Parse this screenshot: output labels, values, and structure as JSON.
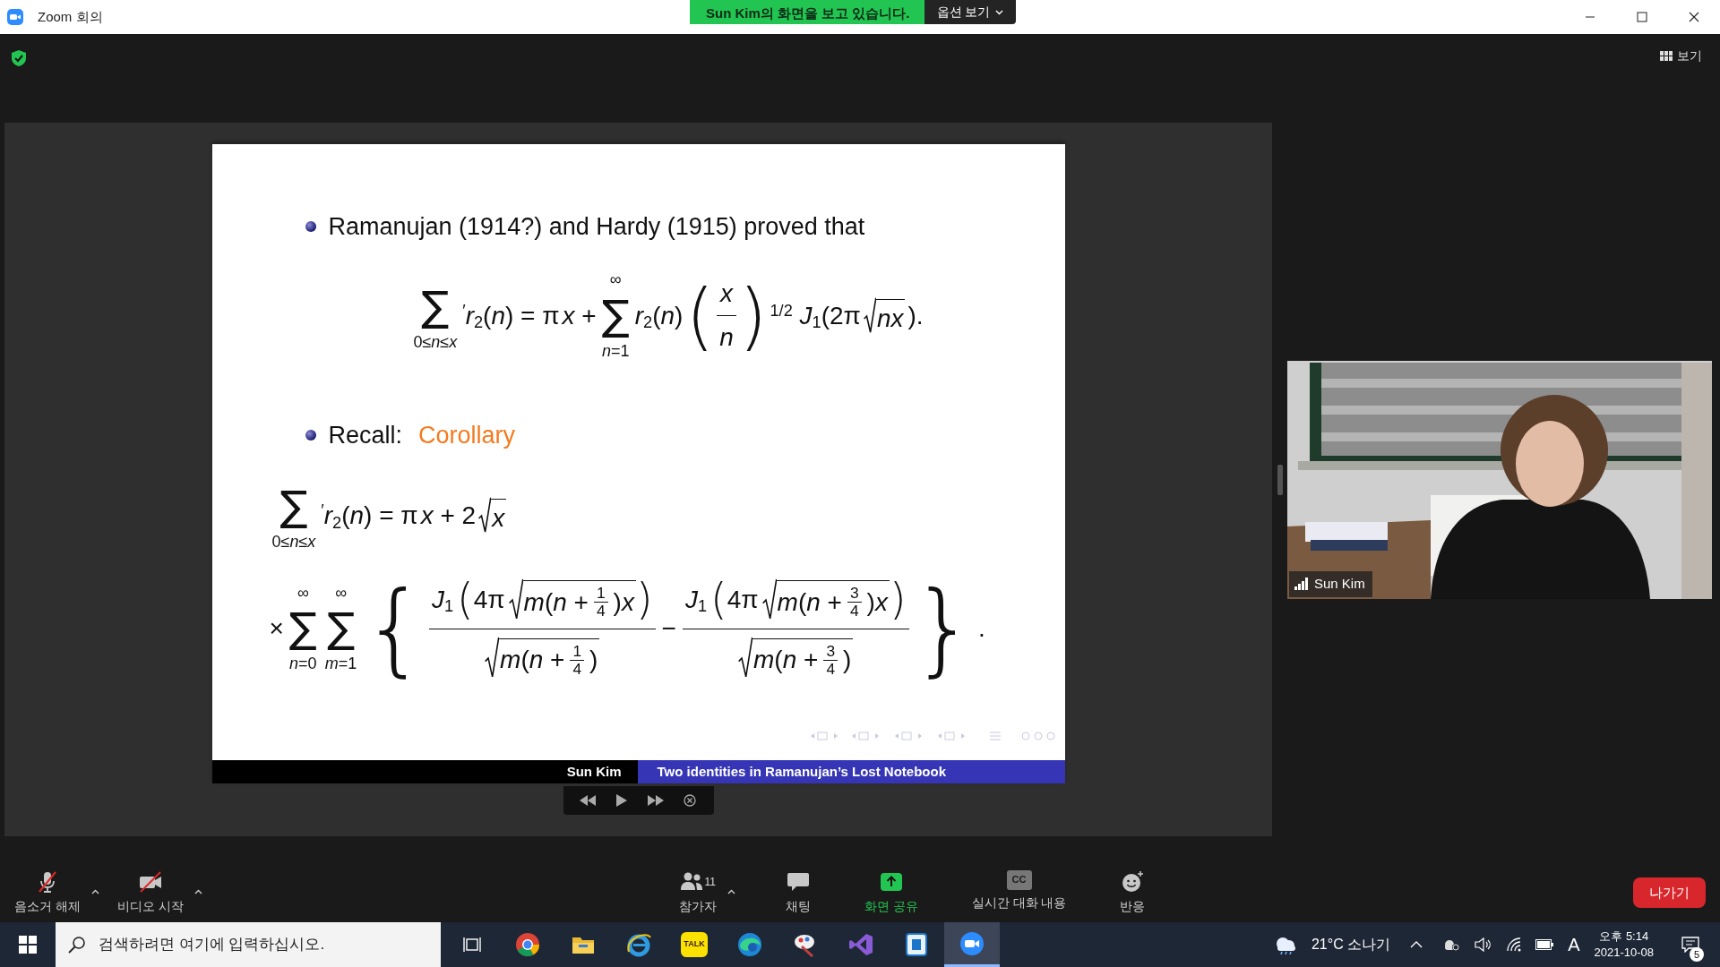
{
  "window": {
    "title": "Zoom 회의"
  },
  "share_banner": {
    "text": "Sun Kim의 화면을 보고 있습니다.",
    "options": "옵션 보기"
  },
  "view_button": "보기",
  "slide": {
    "items": [
      {
        "kind": "bullet",
        "text": "Ramanujan (1914?) and Hardy (1915) proved that"
      },
      {
        "kind": "formula",
        "parts": [
          {
            "kind": "op",
            "symbol": "∑",
            "under": "0≤*n*≤*x*"
          },
          {
            "kind": "t",
            "text": "$^{′}$*r*$_{2}$(*n*) = π"
          },
          {
            "kind": "t",
            "text": "*x* +"
          },
          {
            "kind": "op",
            "symbol": "∑",
            "over": "∞",
            "under": "*n*=1"
          },
          {
            "kind": "t",
            "text": "*r*$_{2}$(*n*)"
          },
          {
            "kind": "fence",
            "open": "(",
            "close": ")",
            "body": [
              {
                "kind": "frac",
                "num": [
                  {
                    "kind": "t",
                    "text": "*x*"
                  }
                ],
                "den": [
                  {
                    "kind": "t",
                    "text": "*n*"
                  }
                ]
              }
            ]
          },
          {
            "kind": "t",
            "text": "$^{1/2}$ *J*$_{1}$(2π"
          },
          {
            "kind": "sqrt",
            "body": [
              {
                "kind": "t",
                "text": "*nx*"
              }
            ]
          },
          {
            "kind": "t",
            "text": ")."
          }
        ]
      },
      {
        "kind": "bullet",
        "text": "Recall:",
        "highlight": "Corollary"
      },
      {
        "kind": "formula",
        "parts": [
          {
            "kind": "op",
            "symbol": "∑",
            "under": "0≤*n*≤*x*"
          },
          {
            "kind": "t",
            "text": "$^{′}$*r*$_{2}$(*n*) = π"
          },
          {
            "kind": "t",
            "text": "*x* + 2"
          },
          {
            "kind": "sqrt",
            "body": [
              {
                "kind": "t",
                "text": "*x*"
              }
            ]
          }
        ]
      },
      {
        "kind": "formula",
        "parts": [
          {
            "kind": "t",
            "text": "×"
          },
          {
            "kind": "op",
            "symbol": "∑",
            "over": "∞",
            "under": "*n*=0"
          },
          {
            "kind": "op",
            "symbol": "∑",
            "over": "∞",
            "under": "*m*=1"
          },
          {
            "kind": "fence",
            "open": "{",
            "close": "}",
            "body": [
              {
                "kind": "frac",
                "num": [
                  {
                    "kind": "t",
                    "text": "*J*$_{1}$"
                  },
                  {
                    "kind": "fence",
                    "open": "(",
                    "close": ")",
                    "body": [
                      {
                        "kind": "t",
                        "text": "4π"
                      },
                      {
                        "kind": "sqrt",
                        "body": [
                          {
                            "kind": "t",
                            "text": "*m*(*n* +"
                          },
                          {
                            "kind": "frac",
                            "num": [
                              {
                                "kind": "t",
                                "text": "1"
                              }
                            ],
                            "den": [
                              {
                                "kind": "t",
                                "text": "4"
                              }
                            ]
                          },
                          {
                            "kind": "t",
                            "text": ")*x*"
                          }
                        ]
                      }
                    ]
                  }
                ],
                "den": [
                  {
                    "kind": "sqrt",
                    "body": [
                      {
                        "kind": "t",
                        "text": "*m*(*n* +"
                      },
                      {
                        "kind": "frac",
                        "num": [
                          {
                            "kind": "t",
                            "text": "1"
                          }
                        ],
                        "den": [
                          {
                            "kind": "t",
                            "text": "4"
                          }
                        ]
                      },
                      {
                        "kind": "t",
                        "text": ")"
                      }
                    ]
                  }
                ]
              },
              {
                "kind": "t",
                "text": "−"
              },
              {
                "kind": "frac",
                "num": [
                  {
                    "kind": "t",
                    "text": "*J*$_{1}$"
                  },
                  {
                    "kind": "fence",
                    "open": "(",
                    "close": ")",
                    "body": [
                      {
                        "kind": "t",
                        "text": "4π"
                      },
                      {
                        "kind": "sqrt",
                        "body": [
                          {
                            "kind": "t",
                            "text": "*m*(*n* +"
                          },
                          {
                            "kind": "frac",
                            "num": [
                              {
                                "kind": "t",
                                "text": "3"
                              }
                            ],
                            "den": [
                              {
                                "kind": "t",
                                "text": "4"
                              }
                            ]
                          },
                          {
                            "kind": "t",
                            "text": ")*x*"
                          }
                        ]
                      }
                    ]
                  }
                ],
                "den": [
                  {
                    "kind": "sqrt",
                    "body": [
                      {
                        "kind": "t",
                        "text": "*m*(*n* +"
                      },
                      {
                        "kind": "frac",
                        "num": [
                          {
                            "kind": "t",
                            "text": "3"
                          }
                        ],
                        "den": [
                          {
                            "kind": "t",
                            "text": "4"
                          }
                        ]
                      },
                      {
                        "kind": "t",
                        "text": ")"
                      }
                    ]
                  }
                ]
              }
            ]
          },
          {
            "kind": "t",
            "text": "."
          }
        ]
      }
    ],
    "footer": {
      "author": "Sun Kim",
      "title": "Two identities in Ramanujan’s Lost Notebook"
    }
  },
  "video": {
    "name": "Sun Kim"
  },
  "toolbar": {
    "left": [
      {
        "kind": "mute",
        "label": "음소거 해제",
        "menu": true,
        "highlighted": false
      },
      {
        "kind": "video",
        "label": "비디오 시작",
        "menu": true,
        "highlighted": false
      }
    ],
    "center": [
      {
        "kind": "participants",
        "label": "참가자",
        "count": "11",
        "menu": true,
        "highlighted": false
      },
      {
        "kind": "chat",
        "label": "채팅",
        "menu": false,
        "highlighted": false
      },
      {
        "kind": "share",
        "label": "화면 공유",
        "menu": false,
        "highlighted": true
      },
      {
        "kind": "cc",
        "label": "실시간 대화 내용",
        "glyph": "CC",
        "menu": false,
        "highlighted": false
      },
      {
        "kind": "reaction",
        "label": "반응",
        "menu": false,
        "highlighted": false
      }
    ],
    "leave": "나가기"
  },
  "taskbar": {
    "search_placeholder": "검색하려면 여기에 입력하십시오.",
    "apps": [
      {
        "kind": "chrome",
        "active": false
      },
      {
        "kind": "folder",
        "active": false
      },
      {
        "kind": "ie",
        "active": false
      },
      {
        "kind": "kakao",
        "glyph": "TALK",
        "active": false
      },
      {
        "kind": "edge",
        "active": false
      },
      {
        "kind": "paint",
        "active": false
      },
      {
        "kind": "vs",
        "active": false
      },
      {
        "kind": "dict",
        "active": false
      },
      {
        "kind": "zoom",
        "active": true
      }
    ],
    "weather": "21°C  소나기",
    "ime": "A",
    "time": "오후 5:14",
    "date": "2021-10-08",
    "notifications": "5"
  }
}
